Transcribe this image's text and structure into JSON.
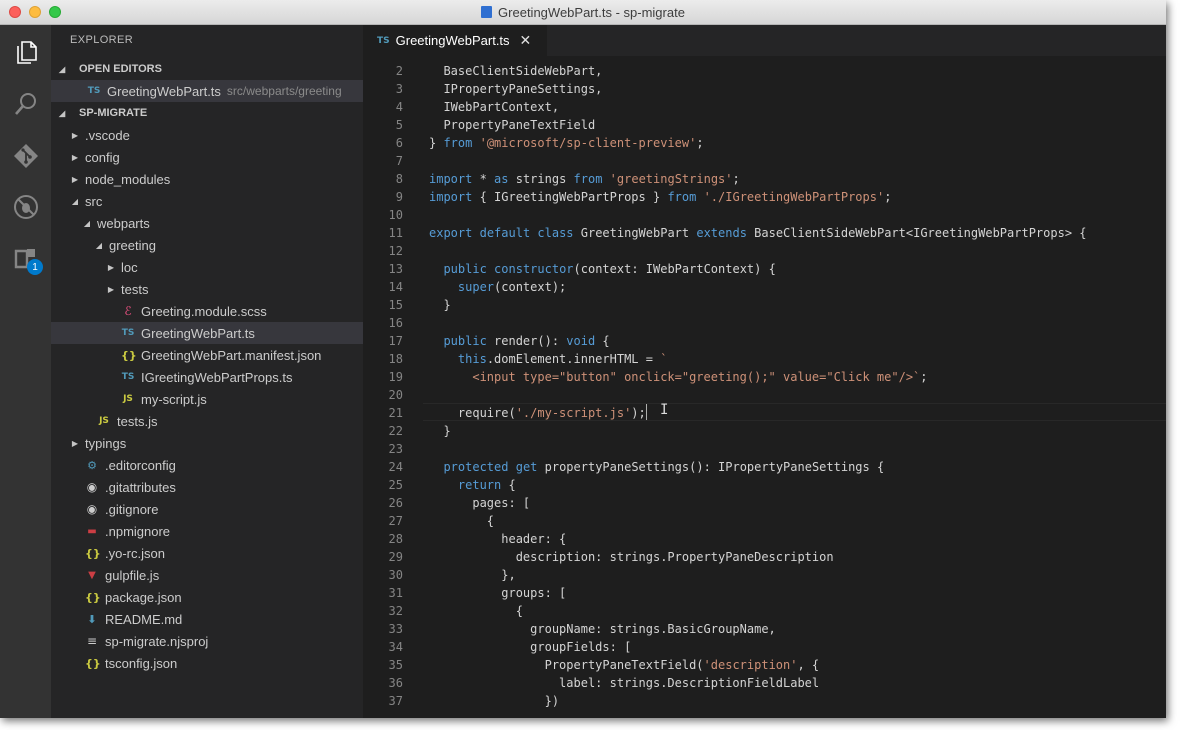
{
  "window": {
    "title": "GreetingWebPart.ts - sp-migrate"
  },
  "activity_bar": {
    "extensions_badge": "1"
  },
  "sidebar": {
    "title": "EXPLORER",
    "open_editors": {
      "header": "OPEN EDITORS",
      "items": [
        {
          "name": "GreetingWebPart.ts",
          "path": "src/webparts/greeting",
          "icon": "TS"
        }
      ]
    },
    "project": {
      "header": "SP-MIGRATE",
      "tree": [
        {
          "label": ".vscode",
          "type": "folder",
          "expanded": false,
          "depth": 0
        },
        {
          "label": "config",
          "type": "folder",
          "expanded": false,
          "depth": 0
        },
        {
          "label": "node_modules",
          "type": "folder",
          "expanded": false,
          "depth": 0
        },
        {
          "label": "src",
          "type": "folder",
          "expanded": true,
          "depth": 0
        },
        {
          "label": "webparts",
          "type": "folder",
          "expanded": true,
          "depth": 1
        },
        {
          "label": "greeting",
          "type": "folder",
          "expanded": true,
          "depth": 2
        },
        {
          "label": "loc",
          "type": "folder",
          "expanded": false,
          "depth": 3
        },
        {
          "label": "tests",
          "type": "folder",
          "expanded": false,
          "depth": 3
        },
        {
          "label": "Greeting.module.scss",
          "type": "file",
          "icon": "scss",
          "depth": 3
        },
        {
          "label": "GreetingWebPart.ts",
          "type": "file",
          "icon": "ts",
          "depth": 3,
          "selected": true
        },
        {
          "label": "GreetingWebPart.manifest.json",
          "type": "file",
          "icon": "json",
          "depth": 3
        },
        {
          "label": "IGreetingWebPartProps.ts",
          "type": "file",
          "icon": "ts",
          "depth": 3
        },
        {
          "label": "my-script.js",
          "type": "file",
          "icon": "js",
          "depth": 3
        },
        {
          "label": "tests.js",
          "type": "file",
          "icon": "js",
          "depth": 1
        },
        {
          "label": "typings",
          "type": "folder",
          "expanded": false,
          "depth": 0
        },
        {
          "label": ".editorconfig",
          "type": "file",
          "icon": "editorconfig",
          "depth": 0
        },
        {
          "label": ".gitattributes",
          "type": "file",
          "icon": "git",
          "depth": 0
        },
        {
          "label": ".gitignore",
          "type": "file",
          "icon": "git",
          "depth": 0
        },
        {
          "label": ".npmignore",
          "type": "file",
          "icon": "npm",
          "depth": 0
        },
        {
          "label": ".yo-rc.json",
          "type": "file",
          "icon": "json",
          "depth": 0
        },
        {
          "label": "gulpfile.js",
          "type": "file",
          "icon": "gulp",
          "depth": 0
        },
        {
          "label": "package.json",
          "type": "file",
          "icon": "json",
          "depth": 0
        },
        {
          "label": "README.md",
          "type": "file",
          "icon": "md",
          "depth": 0
        },
        {
          "label": "sp-migrate.njsproj",
          "type": "file",
          "icon": "lines",
          "depth": 0
        },
        {
          "label": "tsconfig.json",
          "type": "file",
          "icon": "json",
          "depth": 0
        }
      ]
    }
  },
  "tabs": [
    {
      "label": "GreetingWebPart.ts",
      "icon": "TS",
      "close": "✕"
    }
  ],
  "editor": {
    "lines": [
      {
        "n": 2,
        "tokens": [
          [
            "  BaseClientSideWebPart,",
            "p"
          ]
        ]
      },
      {
        "n": 3,
        "tokens": [
          [
            "  IPropertyPaneSettings,",
            "p"
          ]
        ]
      },
      {
        "n": 4,
        "tokens": [
          [
            "  IWebPartContext,",
            "p"
          ]
        ]
      },
      {
        "n": 5,
        "tokens": [
          [
            "  PropertyPaneTextField",
            "p"
          ]
        ]
      },
      {
        "n": 6,
        "tokens": [
          [
            "} ",
            "p"
          ],
          [
            "from",
            "k"
          ],
          [
            " ",
            "p"
          ],
          [
            "'@microsoft/sp-client-preview'",
            "s"
          ],
          [
            ";",
            "p"
          ]
        ]
      },
      {
        "n": 7,
        "tokens": []
      },
      {
        "n": 8,
        "tokens": [
          [
            "import",
            "k"
          ],
          [
            " * ",
            "p"
          ],
          [
            "as",
            "k"
          ],
          [
            " strings ",
            "p"
          ],
          [
            "from",
            "k"
          ],
          [
            " ",
            "p"
          ],
          [
            "'greetingStrings'",
            "s"
          ],
          [
            ";",
            "p"
          ]
        ]
      },
      {
        "n": 9,
        "tokens": [
          [
            "import",
            "k"
          ],
          [
            " { IGreetingWebPartProps } ",
            "p"
          ],
          [
            "from",
            "k"
          ],
          [
            " ",
            "p"
          ],
          [
            "'./IGreetingWebPartProps'",
            "s"
          ],
          [
            ";",
            "p"
          ]
        ]
      },
      {
        "n": 10,
        "tokens": []
      },
      {
        "n": 11,
        "tokens": [
          [
            "export",
            "k"
          ],
          [
            " ",
            "p"
          ],
          [
            "default",
            "k"
          ],
          [
            " ",
            "p"
          ],
          [
            "class",
            "k"
          ],
          [
            " GreetingWebPart ",
            "p"
          ],
          [
            "extends",
            "k"
          ],
          [
            " BaseClientSideWebPart<IGreetingWebPartProps> {",
            "p"
          ]
        ]
      },
      {
        "n": 12,
        "tokens": []
      },
      {
        "n": 13,
        "tokens": [
          [
            "  ",
            "p"
          ],
          [
            "public",
            "k"
          ],
          [
            " ",
            "p"
          ],
          [
            "constructor",
            "k"
          ],
          [
            "(context: IWebPartContext) {",
            "p"
          ]
        ]
      },
      {
        "n": 14,
        "tokens": [
          [
            "    ",
            "p"
          ],
          [
            "super",
            "k"
          ],
          [
            "(context);",
            "p"
          ]
        ]
      },
      {
        "n": 15,
        "tokens": [
          [
            "  }",
            "p"
          ]
        ]
      },
      {
        "n": 16,
        "tokens": []
      },
      {
        "n": 17,
        "tokens": [
          [
            "  ",
            "p"
          ],
          [
            "public",
            "k"
          ],
          [
            " render(): ",
            "p"
          ],
          [
            "void",
            "k"
          ],
          [
            " {",
            "p"
          ]
        ]
      },
      {
        "n": 18,
        "tokens": [
          [
            "    ",
            "p"
          ],
          [
            "this",
            "k"
          ],
          [
            ".domElement.innerHTML = ",
            "p"
          ],
          [
            "`",
            "s"
          ]
        ]
      },
      {
        "n": 19,
        "tokens": [
          [
            "      <input type=\"button\" onclick=\"greeting();\" value=\"Click me\"/>`",
            "s"
          ],
          [
            ";",
            "p"
          ]
        ]
      },
      {
        "n": 20,
        "tokens": []
      },
      {
        "n": 21,
        "tokens": [
          [
            "    require(",
            "p"
          ],
          [
            "'./my-script.js'",
            "s"
          ],
          [
            ");",
            "p"
          ]
        ]
      },
      {
        "n": 22,
        "tokens": [
          [
            "  }",
            "p"
          ]
        ]
      },
      {
        "n": 23,
        "tokens": []
      },
      {
        "n": 24,
        "tokens": [
          [
            "  ",
            "p"
          ],
          [
            "protected",
            "k"
          ],
          [
            " ",
            "p"
          ],
          [
            "get",
            "k"
          ],
          [
            " propertyPaneSettings(): IPropertyPaneSettings {",
            "p"
          ]
        ]
      },
      {
        "n": 25,
        "tokens": [
          [
            "    ",
            "p"
          ],
          [
            "return",
            "k"
          ],
          [
            " {",
            "p"
          ]
        ]
      },
      {
        "n": 26,
        "tokens": [
          [
            "      pages: [",
            "p"
          ]
        ]
      },
      {
        "n": 27,
        "tokens": [
          [
            "        {",
            "p"
          ]
        ]
      },
      {
        "n": 28,
        "tokens": [
          [
            "          header: {",
            "p"
          ]
        ]
      },
      {
        "n": 29,
        "tokens": [
          [
            "            description: strings.PropertyPaneDescription",
            "p"
          ]
        ]
      },
      {
        "n": 30,
        "tokens": [
          [
            "          },",
            "p"
          ]
        ]
      },
      {
        "n": 31,
        "tokens": [
          [
            "          groups: [",
            "p"
          ]
        ]
      },
      {
        "n": 32,
        "tokens": [
          [
            "            {",
            "p"
          ]
        ]
      },
      {
        "n": 33,
        "tokens": [
          [
            "              groupName: strings.BasicGroupName,",
            "p"
          ]
        ]
      },
      {
        "n": 34,
        "tokens": [
          [
            "              groupFields: [",
            "p"
          ]
        ]
      },
      {
        "n": 35,
        "tokens": [
          [
            "                PropertyPaneTextField(",
            "p"
          ],
          [
            "'description'",
            "s"
          ],
          [
            ", {",
            "p"
          ]
        ]
      },
      {
        "n": 36,
        "tokens": [
          [
            "                  label: strings.DescriptionFieldLabel",
            "p"
          ]
        ]
      },
      {
        "n": 37,
        "tokens": [
          [
            "                })",
            "p"
          ]
        ]
      }
    ]
  },
  "colors": {
    "keyword": "#569cd6",
    "string": "#ce9178",
    "plain": "#d4d4d4",
    "line_number": "#858585",
    "accent": "#007acc"
  }
}
